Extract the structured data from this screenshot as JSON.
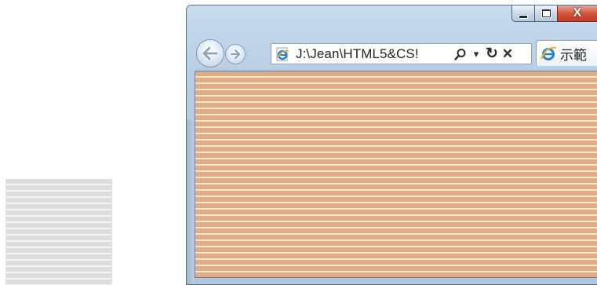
{
  "window": {
    "caption_buttons": {
      "minimize_icon": "minimize-glyph",
      "maximize_icon": "maximize-glyph",
      "close_icon": "close-x-glyph",
      "close_label": "X"
    }
  },
  "navigation": {
    "back_icon": "back-arrow",
    "forward_icon": "forward-arrow",
    "address": "J:\\Jean\\HTML5&CS!",
    "tools": {
      "search_icon": "magnifier",
      "dropdown_icon": "chevron-down",
      "refresh_icon": "refresh",
      "stop_icon": "close-x",
      "dropdown_glyph": "▾",
      "refresh_glyph": "↻",
      "stop_glyph": "✕"
    }
  },
  "tab": {
    "label": "示範",
    "icon": "ie-logo"
  },
  "content": {
    "pattern": "horizontal-stripes",
    "stripe_color": "#e2ab84",
    "gap_color": "#f6e6d6"
  },
  "side_block": {
    "pattern": "horizontal-stripes",
    "stripe_color": "#dcdcdc",
    "gap_color": "#f4f4f4"
  }
}
